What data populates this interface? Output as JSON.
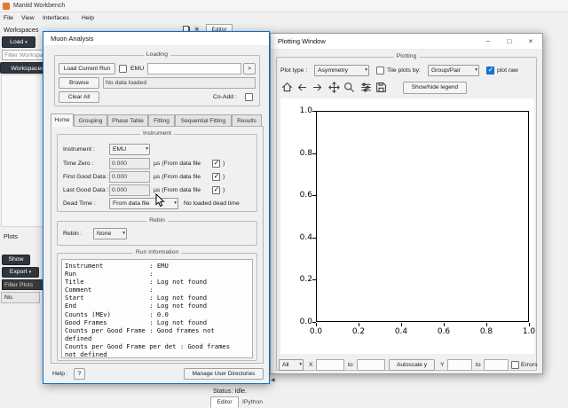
{
  "app": {
    "title": "Mantid Workbench",
    "menu": [
      "File",
      "View",
      "Interfaces",
      "Help"
    ],
    "status": "Status: Idle.",
    "console_tabs": [
      "Editor",
      "IPython"
    ],
    "editor_tab": "Editor"
  },
  "workspaces": {
    "title": "Workspaces",
    "load": "Load",
    "filter_placeholder": "Filter Workspaces",
    "tab": "Workspaces"
  },
  "plots": {
    "title": "Plots",
    "show": "Show",
    "export": "Export",
    "filter_placeholder": "Filter Plots",
    "col_no": "No."
  },
  "muon": {
    "title": "Muon Analysis",
    "loading": {
      "group": "Loading",
      "load_current_run": "Load Current Run",
      "instrument": "EMU",
      "next": ">",
      "browse": "Browse",
      "file": "No data loaded",
      "clear_all": "Clear All",
      "co_add": "Co-Add :"
    },
    "tabs": [
      "Home",
      "Grouping",
      "Phase Table",
      "Fitting",
      "Sequential Fitting",
      "Results"
    ],
    "home": {
      "instrument_group": "Instrument",
      "instrument_label": "Instrument :",
      "instrument_value": "EMU",
      "time_zero_label": "Time Zero :",
      "time_zero_value": "0.000",
      "first_good_label": "First Good Data :",
      "first_good_value": "0.000",
      "last_good_label": "Last Good Data :",
      "last_good_value": "0.000",
      "us_from_file": "µs (From data file",
      "paren": ")",
      "dead_time_label": "Dead Time :",
      "dead_time_value": "From data file",
      "dead_time_status": "No loaded dead time",
      "rebin_group": "Rebin",
      "rebin_label": "Rebin :",
      "rebin_value": "None",
      "run_info_group": "Run Information",
      "run_info": "Instrument            : EMU\nRun                   :\nTitle                 : Log not found\nComment               :\nStart                 : Log not found\nEnd                   : Log not found\nCounts (MEv)          : 0.0\nGood Frames           : Log not found\nCounts per Good Frame : Good frames not\ndefined\nCounts per Good Frame per det : Good frames\nnot defined"
    },
    "help_label": "Help :",
    "help_button": "?",
    "manage_dirs": "Manage User Directories"
  },
  "plotting": {
    "title": "Plotting Window",
    "group": "Plotting",
    "plot_type_label": "Plot type :",
    "plot_type_value": "Asymmetry",
    "tile_label": "Tile plots by:",
    "tile_value": "Group/Pair",
    "plot_raw": "plot raw",
    "legend_button": "Show/hide legend",
    "selector": "All",
    "x_label": "X",
    "to": "to",
    "autoscale": "Autoscale y",
    "y_label": "Y",
    "errors": "Errors"
  },
  "chart_data": {
    "type": "line",
    "title": "",
    "xlabel": "",
    "ylabel": "",
    "x_ticks": [
      "0.0",
      "0.2",
      "0.4",
      "0.6",
      "0.8",
      "1.0"
    ],
    "y_ticks": [
      "1.0",
      "0.8",
      "0.6",
      "0.4",
      "0.2",
      "0.0"
    ],
    "xlim": [
      0,
      1
    ],
    "ylim": [
      0,
      1
    ],
    "series": []
  },
  "colors": {
    "accent": "#0a6fc2",
    "dark_button": "#2f3640",
    "window_bg": "#f0f0f0"
  },
  "icons": {
    "check": "✓",
    "arrow": "▾",
    "minimize": "–",
    "maximize": "□",
    "close": "×",
    "menu": "≡",
    "collapse": "◀"
  }
}
